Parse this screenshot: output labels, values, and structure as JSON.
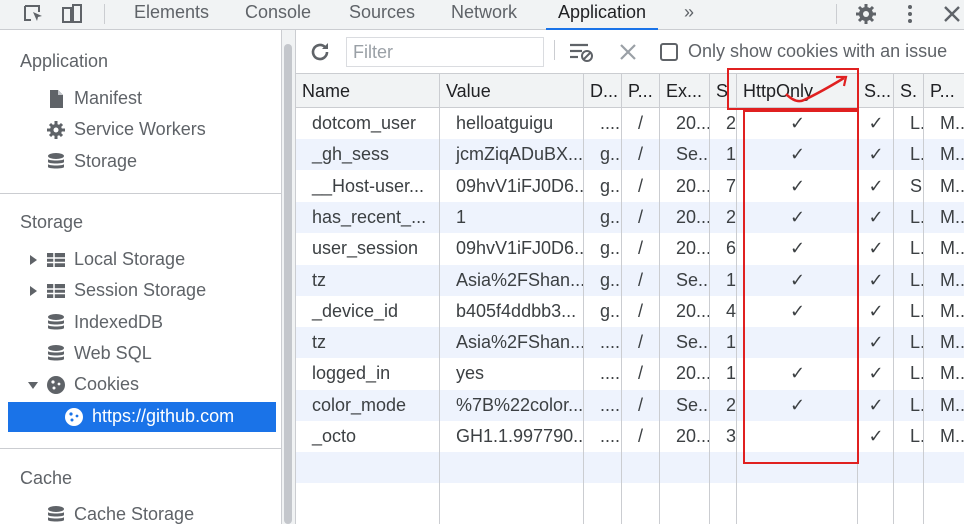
{
  "tabs": [
    "Elements",
    "Console",
    "Sources",
    "Network",
    "Application",
    "»"
  ],
  "sidebar": {
    "application_heading": "Application",
    "application_items": [
      "Manifest",
      "Service Workers",
      "Storage"
    ],
    "storage_heading": "Storage",
    "storage_items": [
      "Local Storage",
      "Session Storage",
      "IndexedDB",
      "Web SQL",
      "Cookies"
    ],
    "cookie_origin": "https://github.com",
    "cache_heading": "Cache",
    "cache_items": [
      "Cache Storage"
    ]
  },
  "toolbar": {
    "filter_placeholder": "Filter",
    "issue_checkbox_label": "Only show cookies with an issue"
  },
  "table": {
    "headers": [
      "Name",
      "Value",
      "D...",
      "P...",
      "Ex...",
      "S",
      "HttpOnly",
      "S...",
      "S.",
      "P..."
    ],
    "check_mark": "✓",
    "rows": [
      {
        "name": "dotcom_user",
        "value": "helloatguigu",
        "domain": "....",
        "path": "/",
        "expires": "20...",
        "size": "2...",
        "httponly": true,
        "secure": true,
        "samesite": "L...",
        "priority": "M..."
      },
      {
        "name": "_gh_sess",
        "value": "jcmZiqADuBX...",
        "domain": "g...",
        "path": "/",
        "expires": "Se...",
        "size": "1...",
        "httponly": true,
        "secure": true,
        "samesite": "L...",
        "priority": "M..."
      },
      {
        "name": "__Host-user...",
        "value": "09hvV1iFJ0D6...",
        "domain": "g...",
        "path": "/",
        "expires": "20...",
        "size": "7...",
        "httponly": true,
        "secure": true,
        "samesite": "S...",
        "priority": "M..."
      },
      {
        "name": "has_recent_...",
        "value": "1",
        "domain": "g...",
        "path": "/",
        "expires": "20...",
        "size": "2...",
        "httponly": true,
        "secure": true,
        "samesite": "L...",
        "priority": "M..."
      },
      {
        "name": "user_session",
        "value": "09hvV1iFJ0D6...",
        "domain": "g...",
        "path": "/",
        "expires": "20...",
        "size": "6...",
        "httponly": true,
        "secure": true,
        "samesite": "L...",
        "priority": "M..."
      },
      {
        "name": "tz",
        "value": "Asia%2FShan...",
        "domain": "g...",
        "path": "/",
        "expires": "Se...",
        "size": "1...",
        "httponly": true,
        "secure": true,
        "samesite": "L...",
        "priority": "M..."
      },
      {
        "name": "_device_id",
        "value": "b405f4ddbb3...",
        "domain": "g...",
        "path": "/",
        "expires": "20...",
        "size": "4...",
        "httponly": true,
        "secure": true,
        "samesite": "L...",
        "priority": "M..."
      },
      {
        "name": "tz",
        "value": "Asia%2FShan...",
        "domain": "....",
        "path": "/",
        "expires": "Se...",
        "size": "1...",
        "httponly": false,
        "secure": true,
        "samesite": "L...",
        "priority": "M..."
      },
      {
        "name": "logged_in",
        "value": "yes",
        "domain": "....",
        "path": "/",
        "expires": "20...",
        "size": "1...",
        "httponly": true,
        "secure": true,
        "samesite": "L...",
        "priority": "M..."
      },
      {
        "name": "color_mode",
        "value": "%7B%22color...",
        "domain": "....",
        "path": "/",
        "expires": "Se...",
        "size": "2...",
        "httponly": true,
        "secure": true,
        "samesite": "L...",
        "priority": "M..."
      },
      {
        "name": "_octo",
        "value": "GH1.1.997790...",
        "domain": "....",
        "path": "/",
        "expires": "20...",
        "size": "3...",
        "httponly": false,
        "secure": true,
        "samesite": "L...",
        "priority": "M..."
      }
    ]
  },
  "colors": {
    "accent": "#1a73e8",
    "annotation": "#e02020",
    "row_alt": "#eef3fd"
  }
}
